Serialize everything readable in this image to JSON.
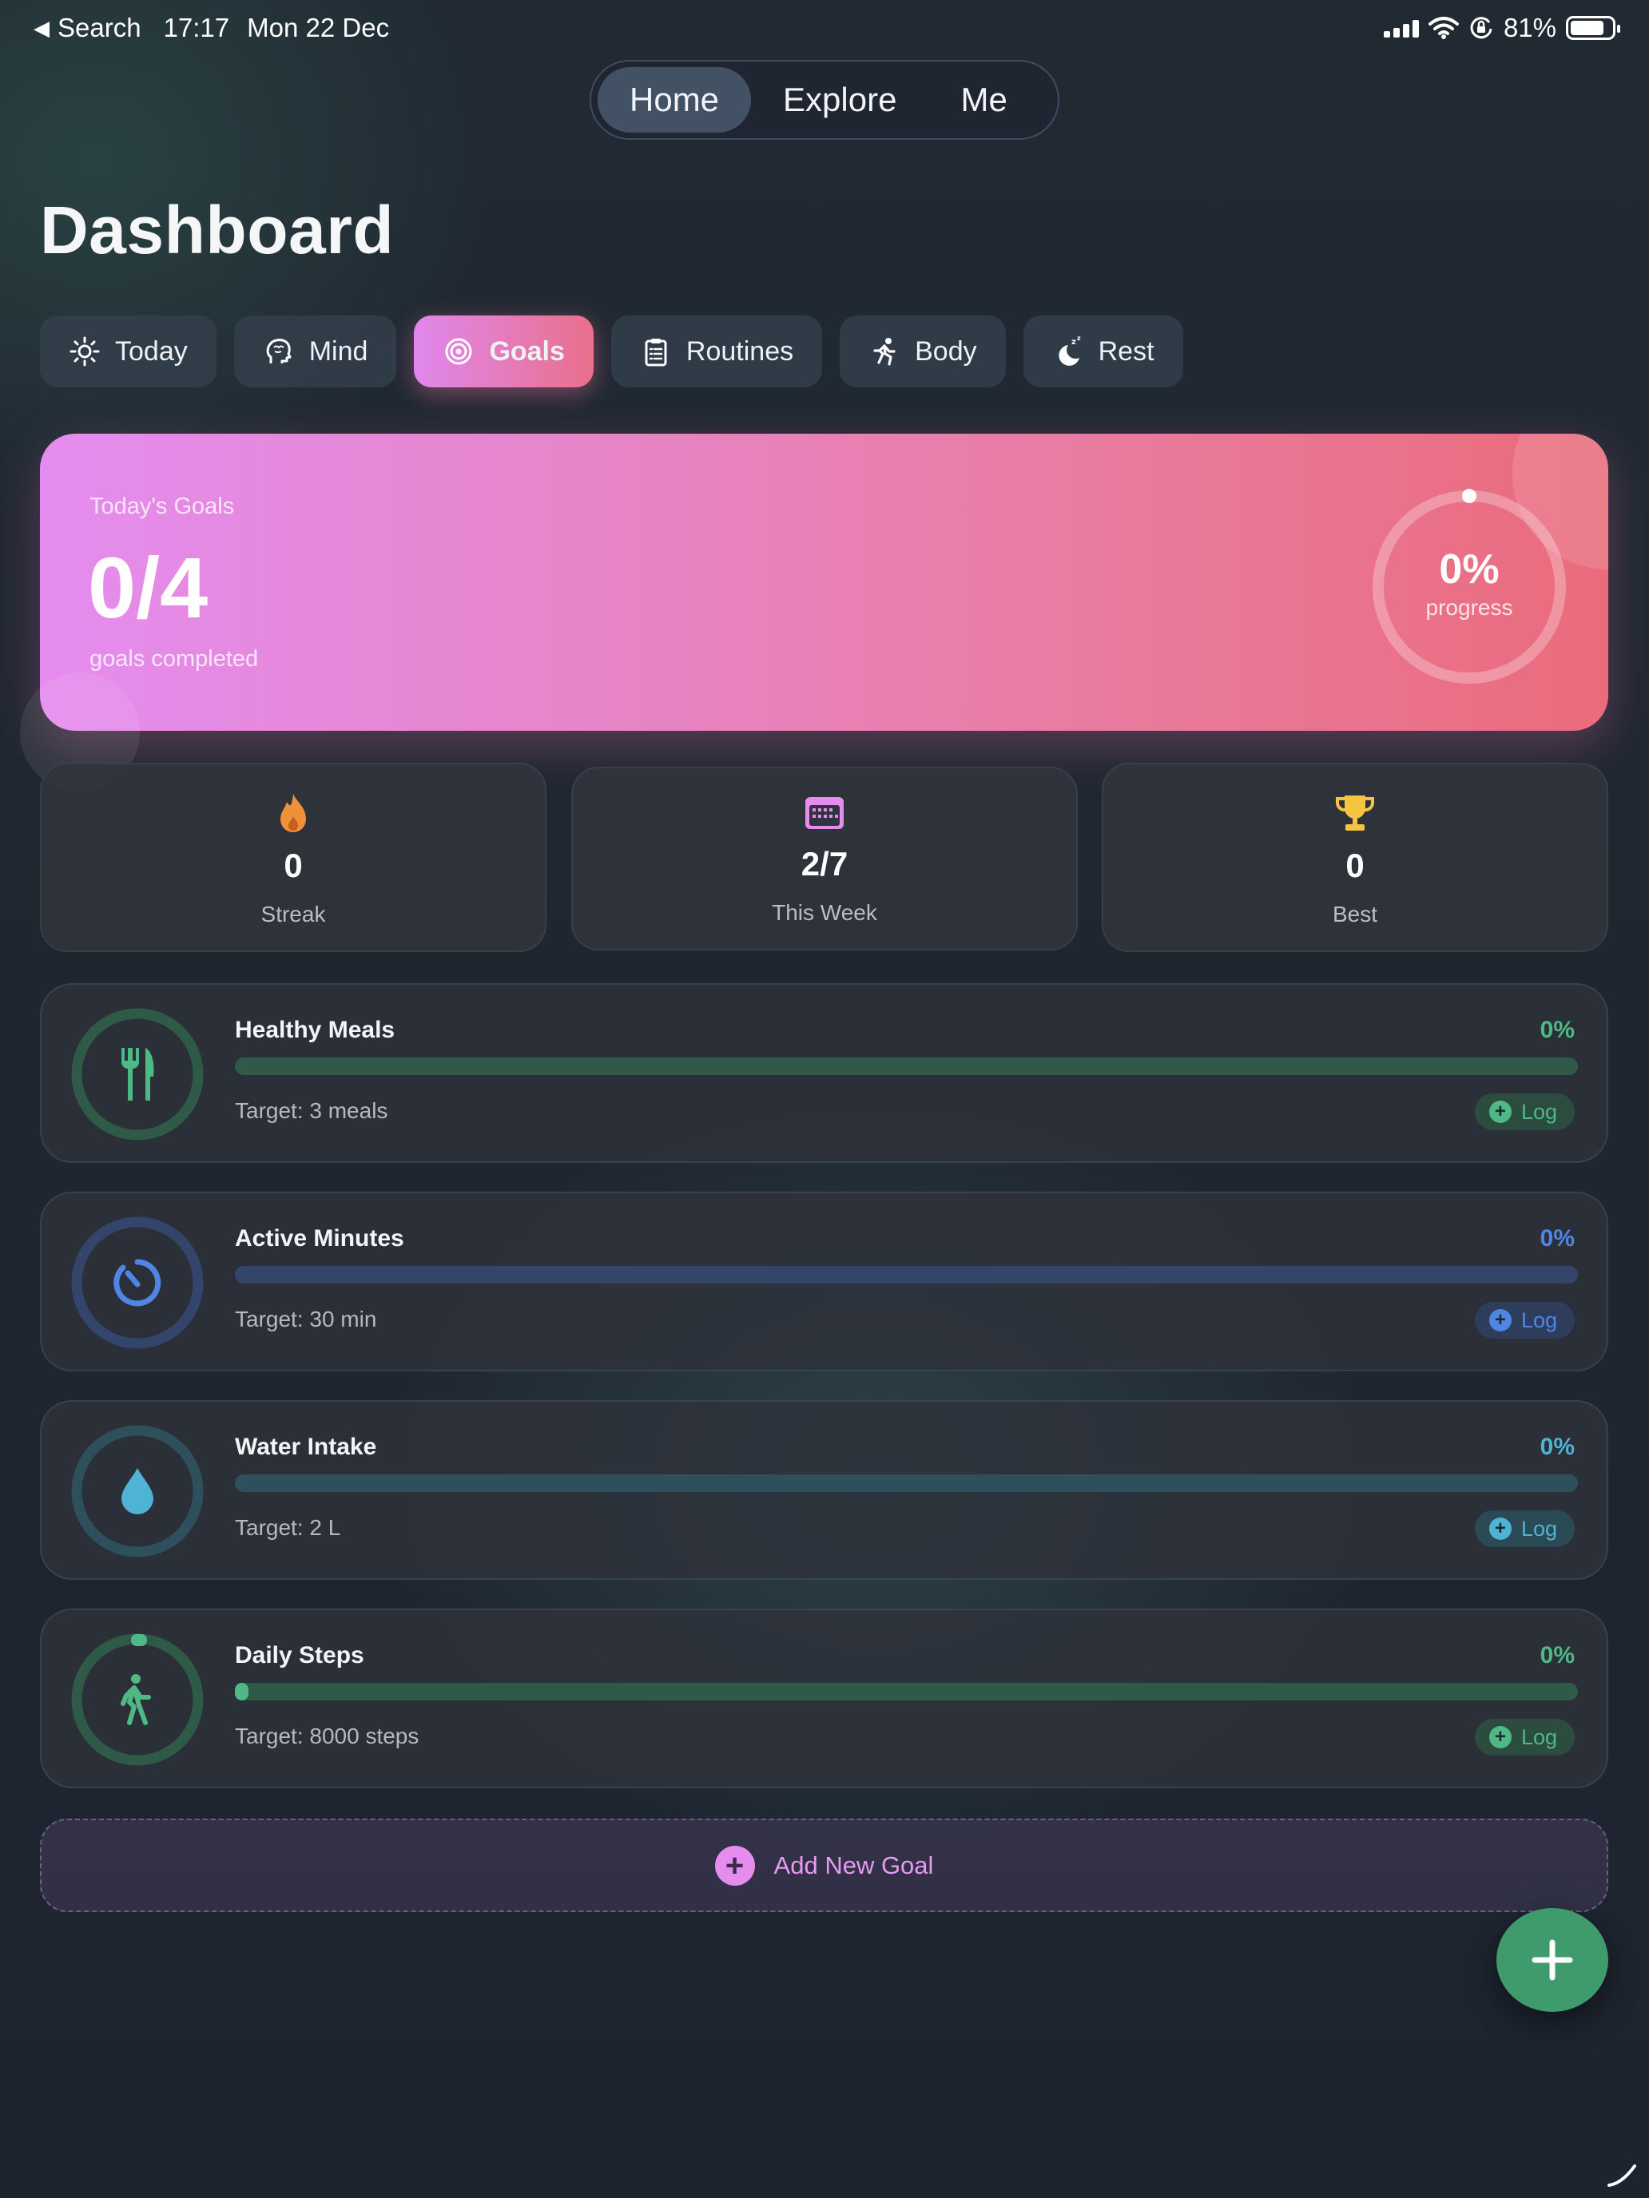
{
  "status_bar": {
    "back_label": "Search",
    "time": "17:17",
    "date": "Mon 22 Dec",
    "battery": "81%"
  },
  "top_nav": {
    "tabs": [
      {
        "label": "Home",
        "active": true
      },
      {
        "label": "Explore",
        "active": false
      },
      {
        "label": "Me",
        "active": false
      }
    ]
  },
  "page": {
    "title": "Dashboard"
  },
  "categories": [
    {
      "label": "Today",
      "icon": "sun-icon",
      "active": false
    },
    {
      "label": "Mind",
      "icon": "brain-icon",
      "active": false
    },
    {
      "label": "Goals",
      "icon": "target-icon",
      "active": true
    },
    {
      "label": "Routines",
      "icon": "clipboard-icon",
      "active": false
    },
    {
      "label": "Body",
      "icon": "running-icon",
      "active": false
    },
    {
      "label": "Rest",
      "icon": "moon-icon",
      "active": false
    }
  ],
  "summary": {
    "label": "Today's Goals",
    "value": "0/4",
    "sub": "goals completed",
    "progress_pct": "0%",
    "progress_label": "progress",
    "progress": 0
  },
  "stats": [
    {
      "value": "0",
      "label": "Streak",
      "icon": "flame-icon",
      "color": "#f0913a"
    },
    {
      "value": "2/7",
      "label": "This Week",
      "icon": "calendar-icon",
      "color": "#e58cef"
    },
    {
      "value": "0",
      "label": "Best",
      "icon": "trophy-icon",
      "color": "#f5c542"
    }
  ],
  "goals": [
    {
      "name": "Healthy Meals",
      "pct": "0%",
      "target": "Target: 3 meals",
      "log": "Log",
      "icon": "utensils-icon",
      "color": "#4fb985",
      "track": "#2f5a48",
      "progress": 0
    },
    {
      "name": "Active Minutes",
      "pct": "0%",
      "target": "Target: 30 min",
      "log": "Log",
      "icon": "timer-icon",
      "color": "#4f86e6",
      "track": "#33456a",
      "progress": 0
    },
    {
      "name": "Water Intake",
      "pct": "0%",
      "target": "Target: 2 L",
      "log": "Log",
      "icon": "water-drop-icon",
      "color": "#4fb3d4",
      "track": "#2e505c",
      "progress": 0
    },
    {
      "name": "Daily Steps",
      "pct": "0%",
      "target": "Target: 8000 steps",
      "log": "Log",
      "icon": "walking-icon",
      "color": "#4fb985",
      "track": "#2f5a48",
      "progress": 0.004
    }
  ],
  "add_goal": {
    "label": "Add New Goal"
  },
  "colors": {
    "accent": "#e58cef",
    "fab": "#3f9a6c"
  }
}
